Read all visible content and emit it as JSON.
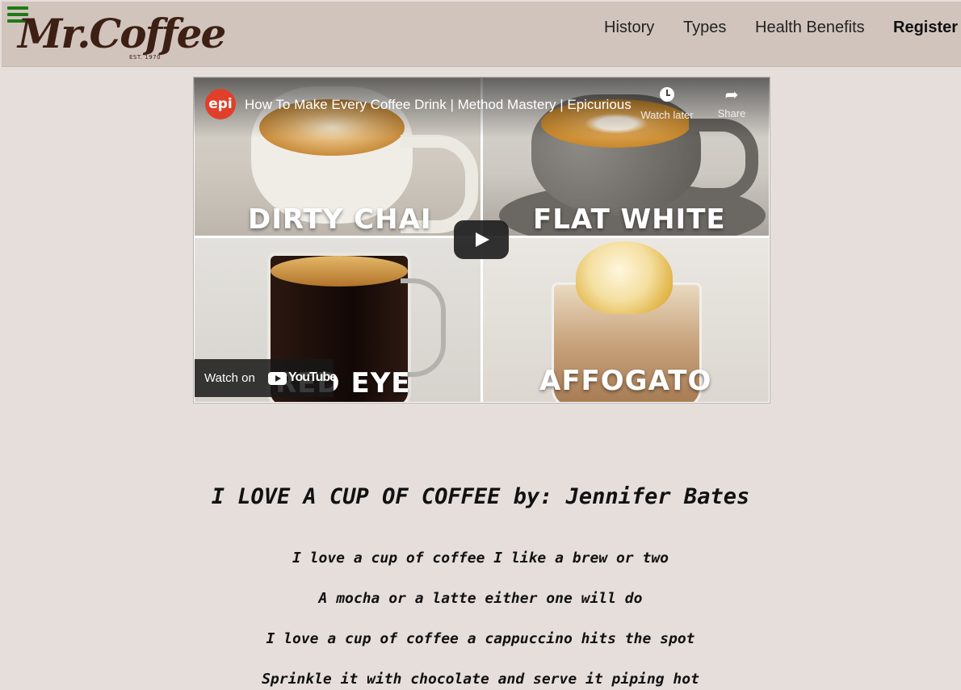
{
  "header": {
    "logo": {
      "text": "Mr.Coffee",
      "est": "EST. 1970"
    },
    "nav": [
      "History",
      "Types",
      "Health Benefits",
      "Register"
    ]
  },
  "video": {
    "channel": "epi",
    "title": "How To Make Every Coffee Drink | Method Mastery | Epicurious",
    "watch_later": "Watch later",
    "share": "Share",
    "watch_on": "Watch on",
    "youtube": "YouTube",
    "captions": [
      "DIRTY CHAI",
      "FLAT WHITE",
      "RED EYE",
      "AFFOGATO"
    ]
  },
  "poem": {
    "title": "I LOVE A CUP OF COFFEE by: Jennifer Bates",
    "lines": [
      "I love a cup of coffee I like a brew or two",
      "A mocha or a latte either one will do",
      "I love a cup of coffee a cappuccino hits the spot",
      "Sprinkle it with chocolate and serve it piping hot"
    ]
  }
}
